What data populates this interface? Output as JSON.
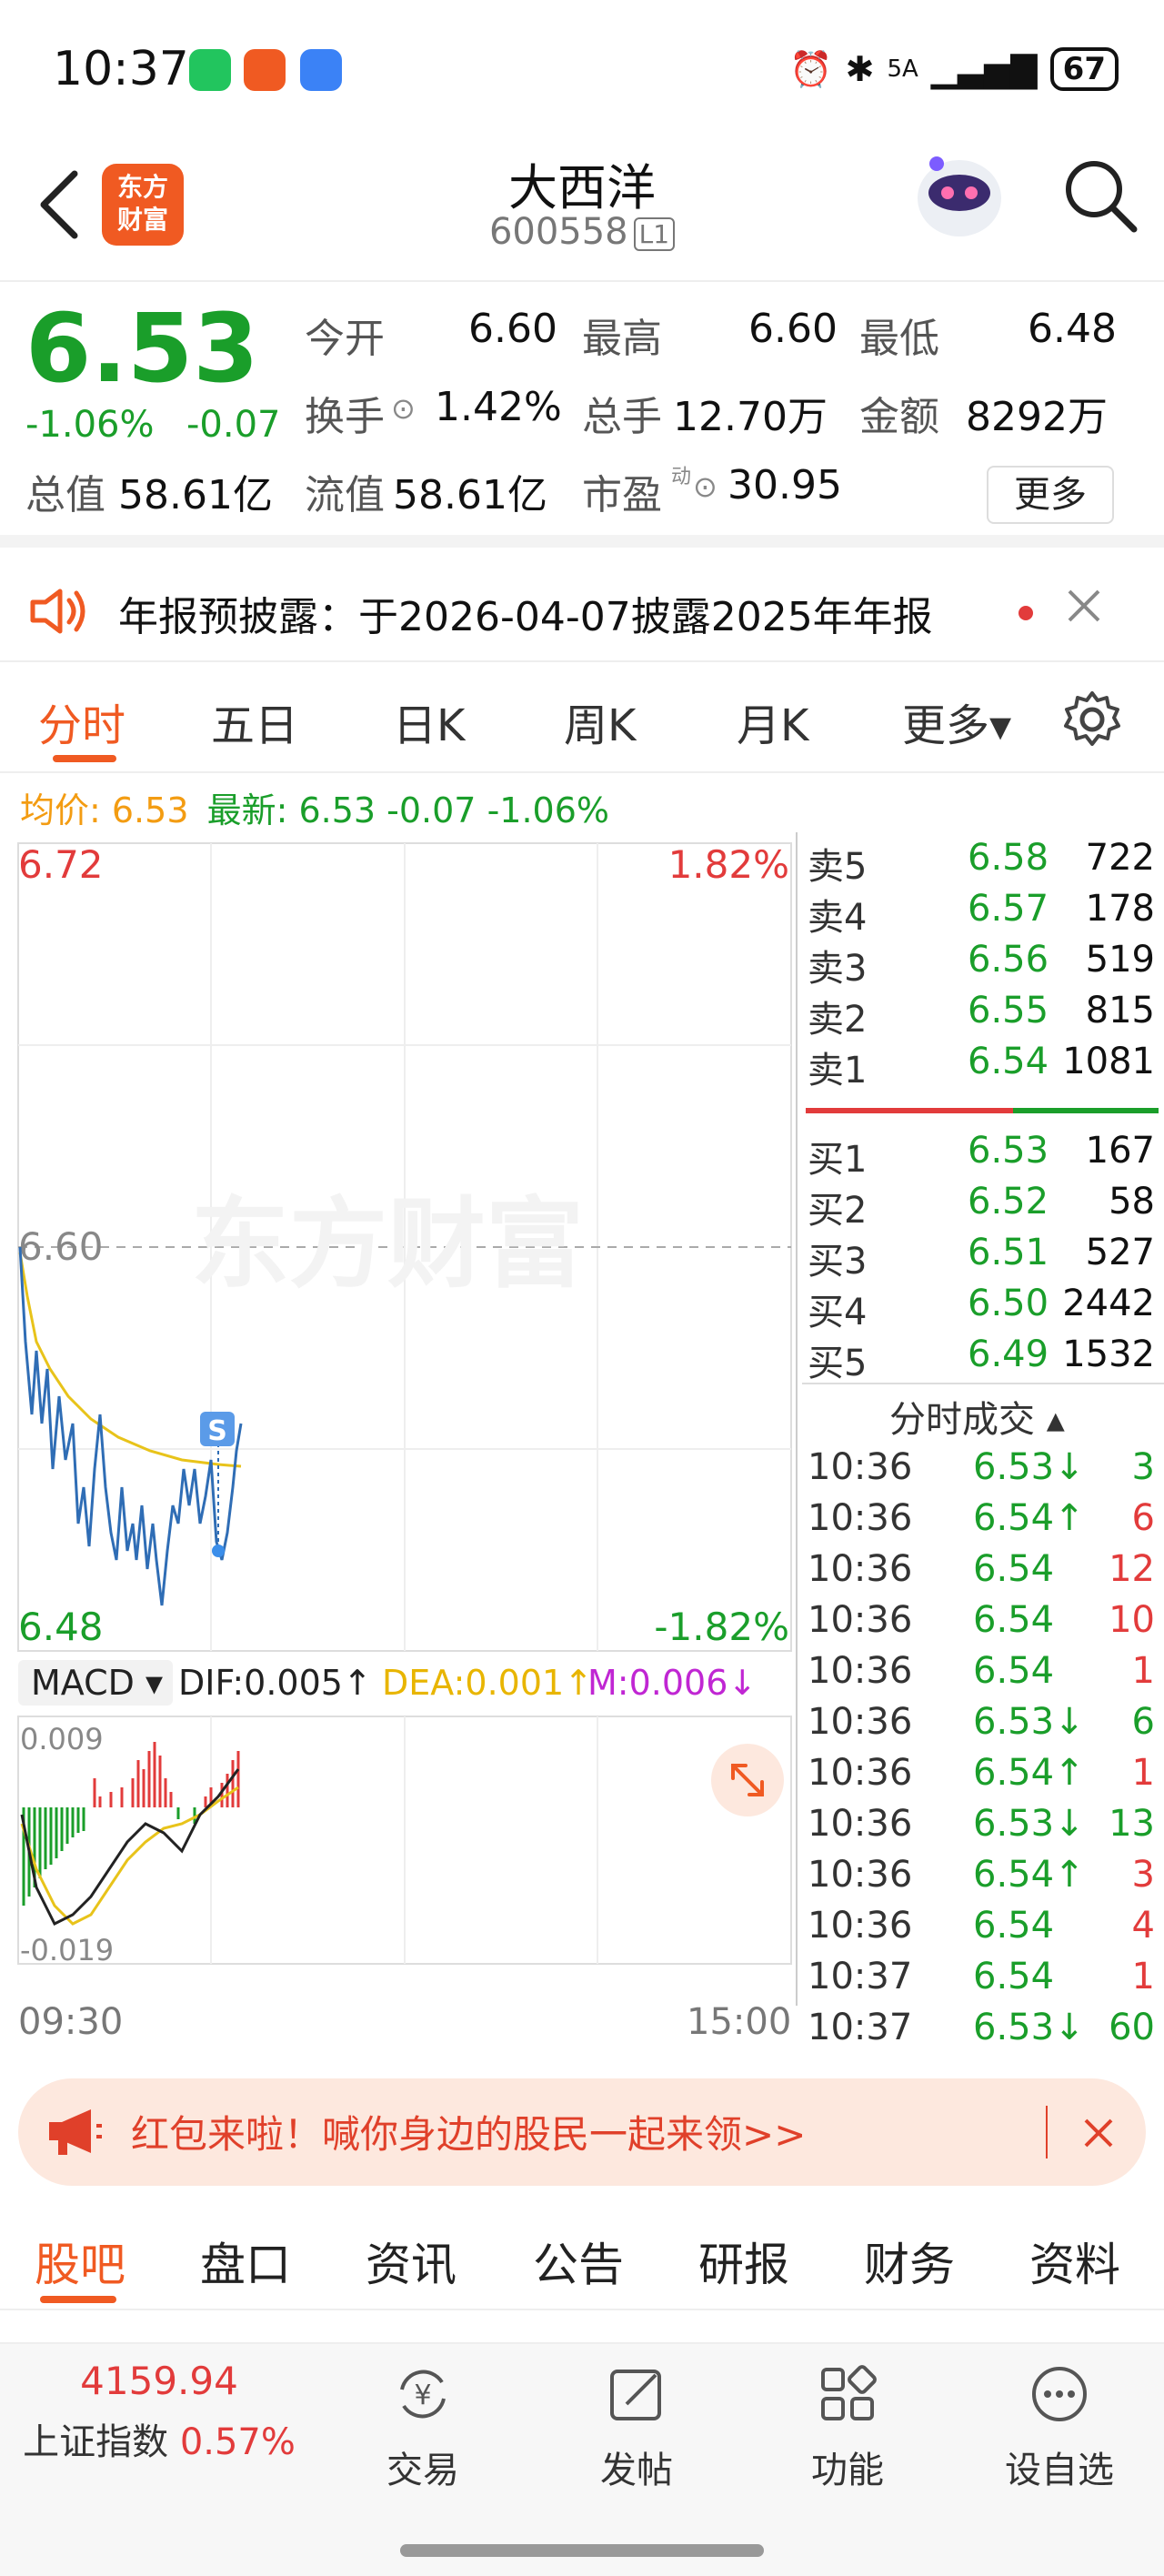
{
  "status_bar": {
    "time": "10:37",
    "network": "5A",
    "battery": "67"
  },
  "header": {
    "title": "大西洋",
    "code": "600558",
    "level": "L1",
    "brand_line1": "东方",
    "brand_line2": "财富"
  },
  "quote": {
    "price": "6.53",
    "change_pct": "-1.06%",
    "change": "-0.07",
    "fields": {
      "open_label": "今开",
      "open": "6.60",
      "high_label": "最高",
      "high": "6.60",
      "low_label": "最低",
      "low": "6.48",
      "turnover_label": "换手",
      "turnover": "1.42%",
      "volume_label": "总手",
      "volume": "12.70万",
      "amount_label": "金额",
      "amount": "8292万",
      "mktcap_label": "总值",
      "mktcap": "58.61亿",
      "float_label": "流值",
      "float": "58.61亿",
      "pe_label": "市盈",
      "pe_sup": "动",
      "pe": "30.95"
    },
    "more_label": "更多"
  },
  "notice": {
    "text": "年报预披露：于2026-04-07披露2025年年报"
  },
  "chart_tabs": [
    "分时",
    "五日",
    "日K",
    "周K",
    "月K",
    "更多▾"
  ],
  "legend": {
    "avg_label": "均价: 6.53",
    "latest_label": "最新: 6.53 -0.07 -1.06%"
  },
  "chart_labels": {
    "price_high": "6.72",
    "pct_high": "1.82%",
    "price_low": "6.48",
    "pct_low": "-1.82%",
    "ref_price": "6.60",
    "watermark": "东方财富",
    "s_marker": "S"
  },
  "macd": {
    "label": "MACD ▾",
    "dif": "DIF:0.005↑",
    "dea": "DEA:0.001↑",
    "m": "M:0.006↓",
    "max": "0.009",
    "min": "-0.019"
  },
  "order_book": {
    "asks": [
      {
        "label": "卖5",
        "price": "6.58",
        "vol": "722"
      },
      {
        "label": "卖4",
        "price": "6.57",
        "vol": "178"
      },
      {
        "label": "卖3",
        "price": "6.56",
        "vol": "519"
      },
      {
        "label": "卖2",
        "price": "6.55",
        "vol": "815"
      },
      {
        "label": "卖1",
        "price": "6.54",
        "vol": "1081"
      }
    ],
    "bids": [
      {
        "label": "买1",
        "price": "6.53",
        "vol": "167"
      },
      {
        "label": "买2",
        "price": "6.52",
        "vol": "58"
      },
      {
        "label": "买3",
        "price": "6.51",
        "vol": "527"
      },
      {
        "label": "买4",
        "price": "6.50",
        "vol": "2442"
      },
      {
        "label": "买5",
        "price": "6.49",
        "vol": "1532"
      }
    ]
  },
  "ticks": {
    "header": "分时成交 ▴",
    "rows": [
      {
        "time": "10:36",
        "price": "6.53↓",
        "vol": "3",
        "dir": "down"
      },
      {
        "time": "10:36",
        "price": "6.54↑",
        "vol": "6",
        "dir": "up"
      },
      {
        "time": "10:36",
        "price": "6.54",
        "vol": "12",
        "dir": "up"
      },
      {
        "time": "10:36",
        "price": "6.54",
        "vol": "10",
        "dir": "up"
      },
      {
        "time": "10:36",
        "price": "6.54",
        "vol": "1",
        "dir": "up"
      },
      {
        "time": "10:36",
        "price": "6.53↓",
        "vol": "6",
        "dir": "down"
      },
      {
        "time": "10:36",
        "price": "6.54↑",
        "vol": "1",
        "dir": "up"
      },
      {
        "time": "10:36",
        "price": "6.53↓",
        "vol": "13",
        "dir": "down"
      },
      {
        "time": "10:36",
        "price": "6.54↑",
        "vol": "3",
        "dir": "up"
      },
      {
        "time": "10:36",
        "price": "6.54",
        "vol": "4",
        "dir": "up"
      },
      {
        "time": "10:37",
        "price": "6.54",
        "vol": "1",
        "dir": "up"
      },
      {
        "time": "10:37",
        "price": "6.53↓",
        "vol": "60",
        "dir": "down"
      }
    ]
  },
  "time_axis": {
    "start": "09:30",
    "end": "15:00"
  },
  "promo": {
    "text": "红包来啦！喊你身边的股民一起来领>>"
  },
  "bottom_tabs": [
    "股吧",
    "盘口",
    "资讯",
    "公告",
    "研报",
    "财务",
    "资料"
  ],
  "nav": {
    "index_value": "4159.94",
    "index_name": "上证指数",
    "index_pct": "0.57%",
    "items": [
      "交易",
      "发帖",
      "功能",
      "设自选"
    ]
  },
  "colors": {
    "up": "#e23b3b",
    "down": "#1a9e2a",
    "accent": "#f05a22",
    "avg_line": "#e8c31a",
    "price_line": "#2f6db5"
  }
}
